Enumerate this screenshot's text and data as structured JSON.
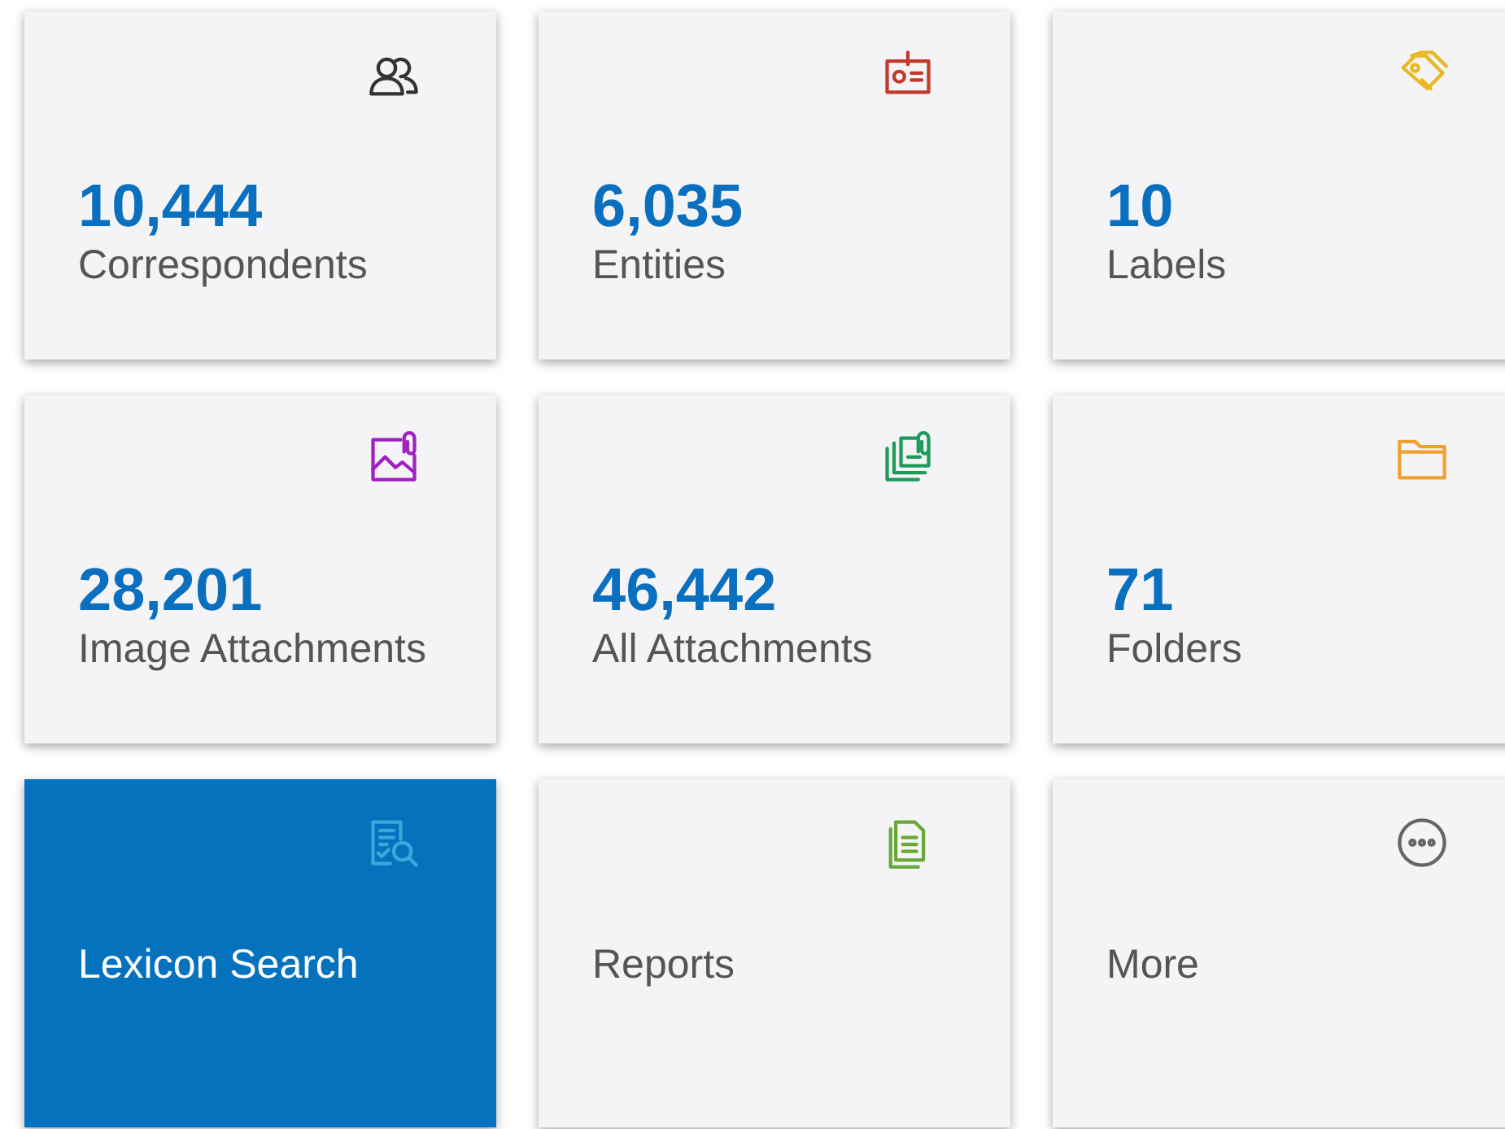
{
  "tiles": [
    {
      "kind": "people",
      "color": "#333333",
      "count": "10,444",
      "label": "Correspondents",
      "selected": false
    },
    {
      "kind": "id-card",
      "color": "#c0392b",
      "count": "6,035",
      "label": "Entities",
      "selected": false
    },
    {
      "kind": "tags",
      "color": "#e8b923",
      "count": "10",
      "label": "Labels",
      "selected": false
    },
    {
      "kind": "image-clip",
      "color": "#a020c0",
      "count": "28,201",
      "label": "Image Attachments",
      "selected": false
    },
    {
      "kind": "stack-clip",
      "color": "#1e9a5a",
      "count": "46,442",
      "label": "All Attachments",
      "selected": false
    },
    {
      "kind": "folder",
      "color": "#f0a030",
      "count": "71",
      "label": "Folders",
      "selected": false
    },
    {
      "kind": "doc-search",
      "color": "#3aa8d8",
      "label": "Lexicon Search",
      "selected": true
    },
    {
      "kind": "documents",
      "color": "#6aa83a",
      "label": "Reports",
      "selected": false
    },
    {
      "kind": "more",
      "color": "#666666",
      "label": "More",
      "selected": false
    }
  ]
}
